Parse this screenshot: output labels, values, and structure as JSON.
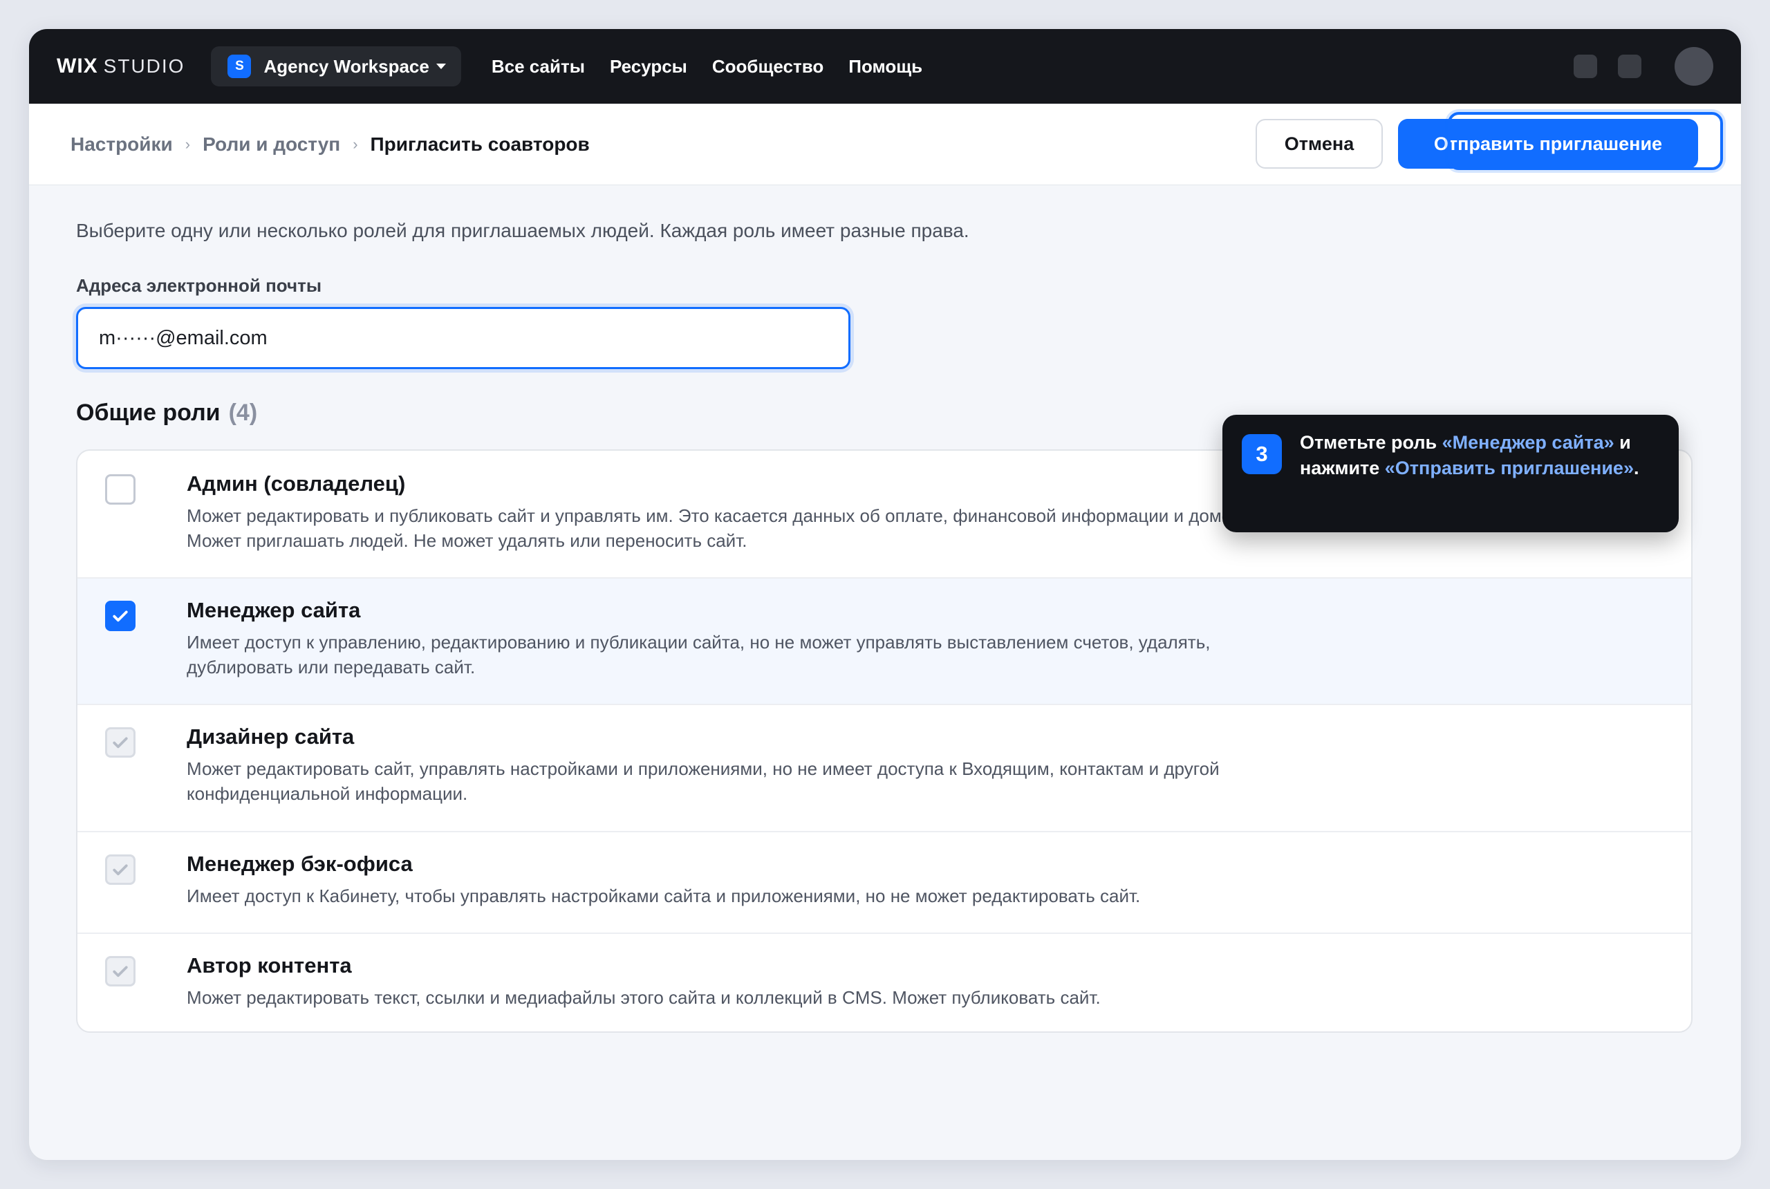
{
  "topbar": {
    "logo_wix": "WIX",
    "logo_studio": "STUDIO",
    "workspace_badge": "S",
    "workspace_name": "Agency Workspace",
    "nav": [
      "Все сайты",
      "Ресурсы",
      "Сообщество",
      "Помощь"
    ]
  },
  "breadcrumb": {
    "items": [
      "Настройки",
      "Роли и доступ"
    ],
    "separator": "›",
    "current": "Пригласить соавторов"
  },
  "actions": {
    "cancel_label": "Отмена",
    "send_label": "Отправить приглашение"
  },
  "intro": "Выберите одну или несколько ролей для приглашаемых людей. Каждая роль имеет разные права.",
  "email": {
    "label": "Адреса электронной почты",
    "value": "m······@email.com"
  },
  "roles_section": {
    "title": "Общие роли",
    "count": "(4)"
  },
  "roles": [
    {
      "name": "Админ (совладелец)",
      "description": "Может редактировать и публиковать сайт и управлять им. Это касается данных об оплате, финансовой информации и доменов. Может приглашать людей. Не может удалять или переносить сайт.",
      "state": "unchecked"
    },
    {
      "name": "Менеджер сайта",
      "description": "Имеет доступ к управлению, редактированию и публикации сайта, но не может управлять выставлением счетов, удалять, дублировать или передавать сайт.",
      "state": "checked"
    },
    {
      "name": "Дизайнер сайта",
      "description": "Может редактировать сайт, управлять настройками и приложениями, но не имеет доступа к Входящим, контактам и другой конфиденциальной информации.",
      "state": "implied"
    },
    {
      "name": "Менеджер бэк-офиса",
      "description": "Имеет доступ к Кабинету, чтобы управлять настройками сайта и приложениями, но не может редактировать сайт.",
      "state": "implied"
    },
    {
      "name": "Автор контента",
      "description": "Может редактировать текст, ссылки и медиафайлы этого сайта и коллекций в CMS. Может публиковать сайт.",
      "state": "implied"
    }
  ],
  "tooltip": {
    "step": "3",
    "text_1": "Отметьте роль ",
    "highlight_1": "«Менеджер сайта»",
    "text_2": " и нажмите ",
    "highlight_2": "«Отправить приглашение»",
    "text_3": "."
  },
  "colors": {
    "accent": "#116dff",
    "topbar_bg": "#15171c",
    "tooltip_bg": "#111318"
  }
}
